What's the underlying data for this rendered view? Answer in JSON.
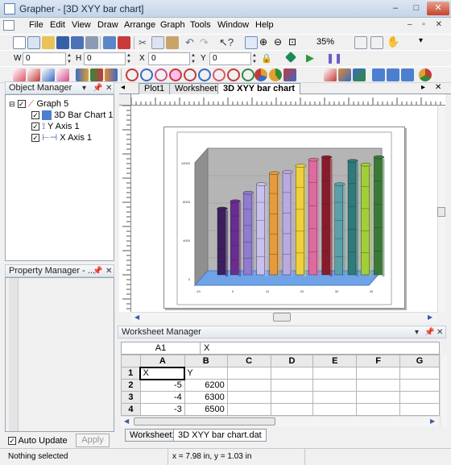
{
  "window": {
    "title": "Grapher - [3D XYY bar chart]",
    "controls": {
      "minimize": "–",
      "maximize": "□",
      "close": "✕"
    }
  },
  "menu": [
    "File",
    "Edit",
    "View",
    "Draw",
    "Arrange",
    "Graph",
    "Tools",
    "Window",
    "Help"
  ],
  "toolbar": {
    "zoom": "35%",
    "w_label": "W",
    "w_value": "0",
    "h_label": "H",
    "h_value": "0",
    "x_label": "X",
    "x_value": "0",
    "y_label": "Y",
    "y_value": "0"
  },
  "object_manager": {
    "title": "Object Manager",
    "tree": [
      {
        "label": "Graph 5",
        "icon": "graph-icon",
        "level": 0
      },
      {
        "label": "3D Bar Chart 1",
        "icon": "bar-chart-3d-icon",
        "level": 1
      },
      {
        "label": "Y Axis 1",
        "icon": "y-axis-icon",
        "level": 1
      },
      {
        "label": "X Axis 1",
        "icon": "x-axis-icon",
        "level": 1
      }
    ]
  },
  "property_manager": {
    "title": "Property Manager - ...",
    "auto_update": "Auto Update",
    "apply": "Apply"
  },
  "doc_tabs": [
    "Plot1",
    "Worksheet1",
    "3D XYY bar chart"
  ],
  "worksheet_manager": {
    "title": "Worksheet Manager",
    "cell_ref": "A1",
    "cell_value": "X",
    "columns": [
      "A",
      "B",
      "C",
      "D",
      "E",
      "F",
      "G"
    ],
    "rows": [
      {
        "n": "1",
        "A": "X",
        "B": "Y"
      },
      {
        "n": "2",
        "A": "-5",
        "B": "6200"
      },
      {
        "n": "3",
        "A": "-4",
        "B": "6300"
      },
      {
        "n": "4",
        "A": "-3",
        "B": "6500"
      }
    ],
    "tabs": [
      "Worksheet1",
      "3D XYY bar chart.dat"
    ]
  },
  "status": {
    "left": "Nothing selected",
    "coords": "x = 7.98 in, y = 1.03 in"
  },
  "chart_data": {
    "type": "bar",
    "categories": [
      "-10",
      "-9",
      "-8",
      "-7",
      "-6",
      "-5",
      "-4",
      "-3",
      "-2",
      "-1",
      "0",
      "1",
      "2",
      "3",
      "4"
    ],
    "values": [
      5400,
      6000,
      6700,
      7400,
      8300,
      8400,
      8900,
      9400,
      9600,
      7400,
      9300,
      9000,
      9600
    ],
    "colors": [
      "#3b1f5e",
      "#6a2d8f",
      "#8f7bcf",
      "#c8c0ee",
      "#e79a3a",
      "#b9aadf",
      "#f0d03a",
      "#e06aa0",
      "#8a1a2a",
      "#5aa0a8",
      "#2f7a7a",
      "#a0cf38",
      "#3a7a36"
    ],
    "yticks": [
      "0",
      "4000",
      "8000",
      "10000"
    ],
    "xticks": [
      "-10",
      "0",
      "10",
      "20",
      "30",
      "40"
    ]
  }
}
